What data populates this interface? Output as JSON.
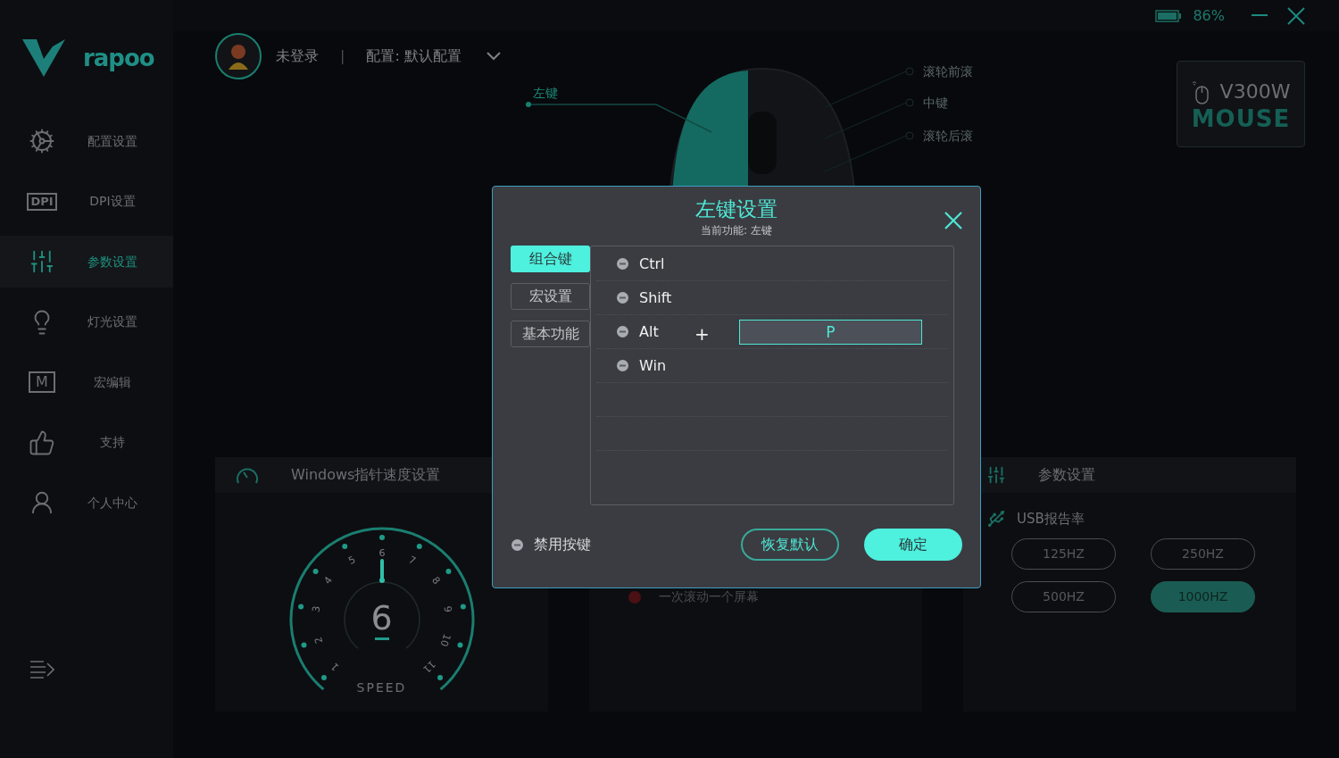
{
  "top_bar": {
    "battery_text": "86%"
  },
  "brand": {
    "name": "rapoo"
  },
  "sidebar": {
    "items": [
      {
        "label": "配置设置",
        "kind": "config",
        "selected": false
      },
      {
        "label": "DPI设置",
        "kind": "dpi",
        "icon_text": "DPI",
        "selected": false
      },
      {
        "label": "参数设置",
        "kind": "params",
        "selected": true
      },
      {
        "label": "灯光设置",
        "kind": "light",
        "selected": false
      },
      {
        "label": "宏编辑",
        "kind": "macro",
        "icon_text": "M",
        "selected": false
      },
      {
        "label": "支持",
        "kind": "support",
        "selected": false
      },
      {
        "label": "个人中心",
        "kind": "personal",
        "selected": false
      }
    ]
  },
  "header": {
    "user": "未登录",
    "separator": "|",
    "profile": "配置: 默认配置"
  },
  "mouse_labels": [
    {
      "label": "左键"
    },
    {
      "label": "滚轮前滚"
    },
    {
      "label": "中键"
    },
    {
      "label": "滚轮后滚"
    }
  ],
  "device_card": {
    "model": "V300W",
    "type": "MOUSE"
  },
  "pointer_panel": {
    "title": "Windows指针速度设置",
    "dial": {
      "value": "6",
      "level": 0.5,
      "ticks": [
        "1",
        "2",
        "3",
        "4",
        "5",
        "6",
        "7",
        "8",
        "9",
        "10",
        "11"
      ],
      "caption": "SPEED"
    }
  },
  "scroll_panel": {
    "items": [
      {
        "label": "一次滚动一个屏幕",
        "selected": false
      }
    ]
  },
  "params_panel": {
    "title": "参数设置",
    "usb_label": "USB报告率",
    "rates": [
      {
        "label": "125HZ",
        "selected": false
      },
      {
        "label": "250HZ",
        "selected": false
      },
      {
        "label": "500HZ",
        "selected": false
      },
      {
        "label": "1000HZ",
        "selected": true
      }
    ]
  },
  "dialog": {
    "title": "左键设置",
    "subtitle": "当前功能: 左键",
    "tabs": [
      {
        "label": "组合键",
        "selected": true
      },
      {
        "label": "宏设置",
        "selected": false
      },
      {
        "label": "基本功能",
        "selected": false
      }
    ],
    "modifiers": [
      {
        "label": "Ctrl"
      },
      {
        "label": "Shift"
      },
      {
        "label": "Alt"
      },
      {
        "label": "Win"
      }
    ],
    "plus": "+",
    "key_value": "P",
    "disable": {
      "label": "禁用按键"
    },
    "buttons": [
      {
        "label": "恢复默认",
        "kind": "secondary"
      },
      {
        "label": "确定",
        "kind": "primary"
      }
    ]
  }
}
